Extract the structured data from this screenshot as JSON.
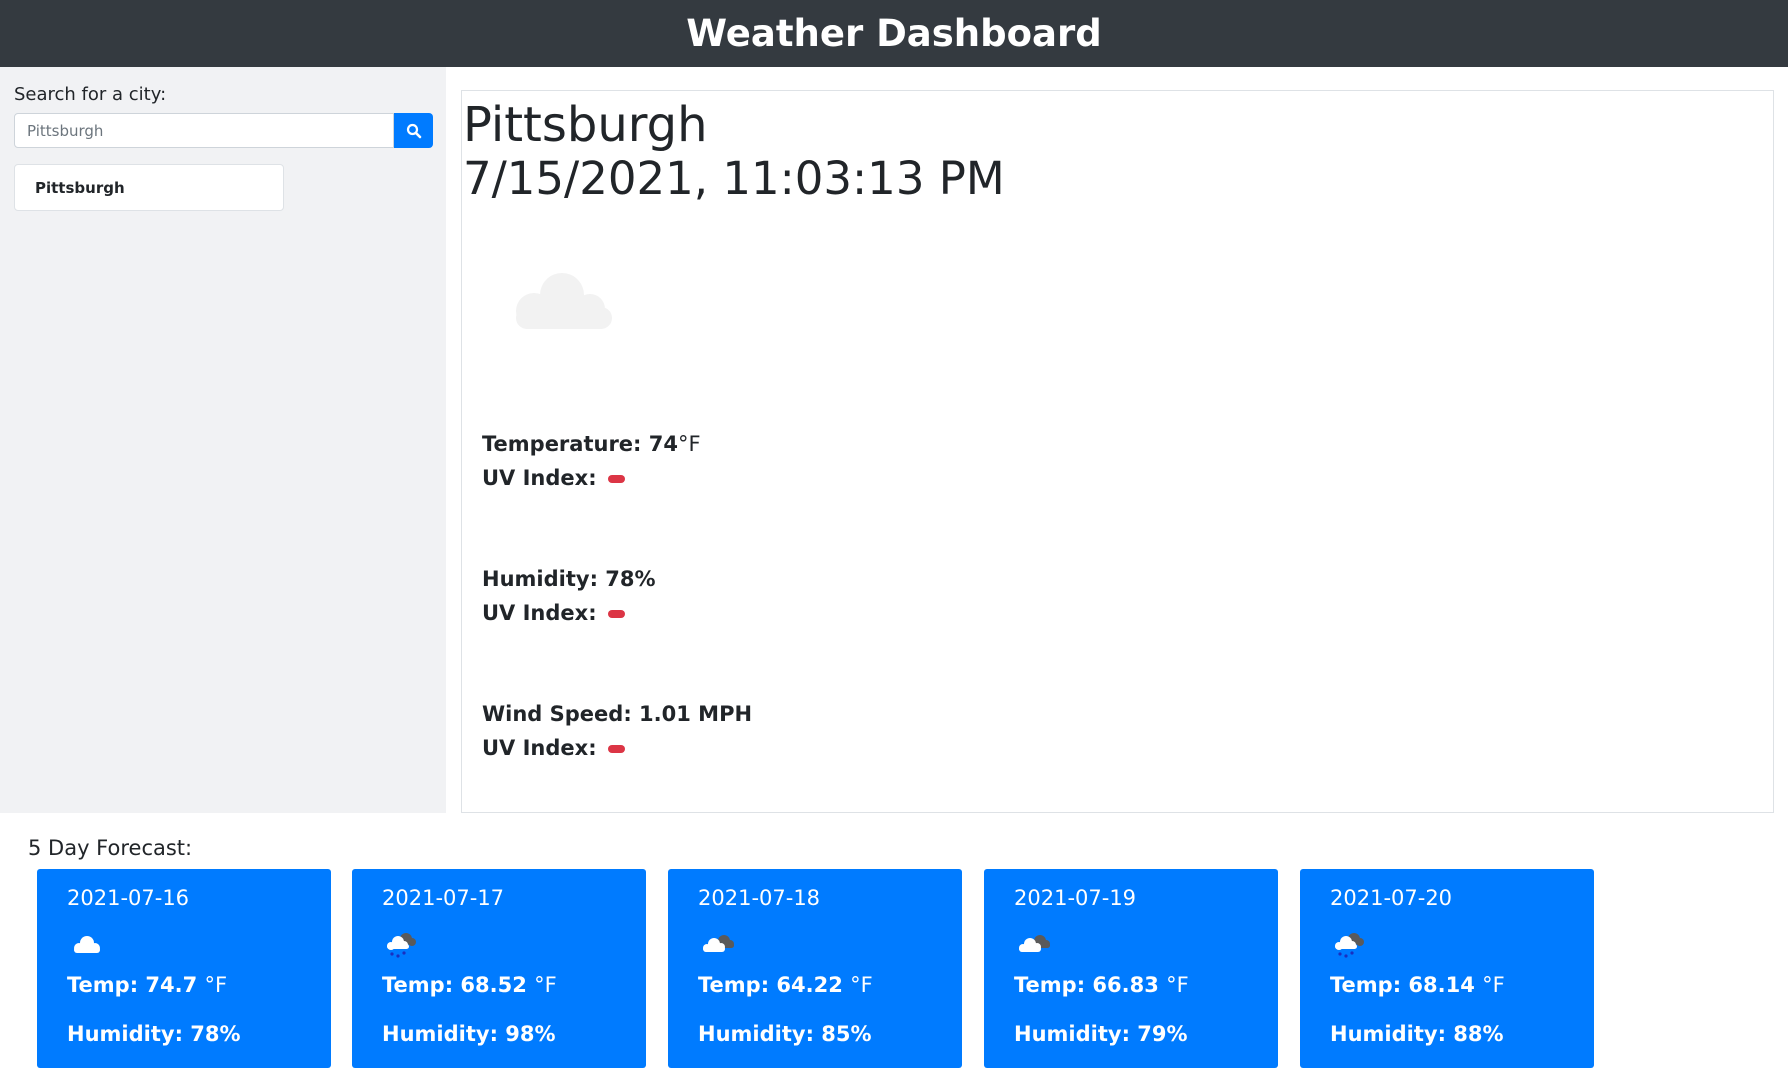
{
  "header": {
    "title": "Weather Dashboard"
  },
  "search": {
    "label": "Search for a city:",
    "value": "Pittsburgh",
    "button_icon": "search-icon"
  },
  "history": [
    {
      "label": "Pittsburgh"
    }
  ],
  "current": {
    "city": "Pittsburgh",
    "datetime": "7/15/2021, 11:03:13 PM",
    "icon": "cloud-icon",
    "temperature_label": "Temperature:",
    "temperature_value": "74",
    "temperature_unit": "°F",
    "humidity_label": "Humidity:",
    "humidity_value": "78%",
    "wind_label": "Wind Speed:",
    "wind_value": "1.01 MPH",
    "uv_label": "UV Index:",
    "uv_badge_color": "#dc3545"
  },
  "forecast": {
    "title": "5 Day Forecast:",
    "temp_label": "Temp:",
    "temp_unit": "°F",
    "humidity_label": "Humidity:",
    "days": [
      {
        "date": "2021-07-16",
        "icon": "cloud-icon",
        "temp": "74.7",
        "humidity": "78%"
      },
      {
        "date": "2021-07-17",
        "icon": "rain-cloud-icon",
        "temp": "68.52",
        "humidity": "98%"
      },
      {
        "date": "2021-07-18",
        "icon": "broken-clouds-icon",
        "temp": "64.22",
        "humidity": "85%"
      },
      {
        "date": "2021-07-19",
        "icon": "broken-clouds-icon",
        "temp": "66.83",
        "humidity": "79%"
      },
      {
        "date": "2021-07-20",
        "icon": "rain-cloud-icon",
        "temp": "68.14",
        "humidity": "88%"
      }
    ]
  },
  "colors": {
    "header_bg": "#343a40",
    "sidebar_bg": "#f1f2f4",
    "accent": "#007bff",
    "uv_badge": "#dc3545"
  }
}
